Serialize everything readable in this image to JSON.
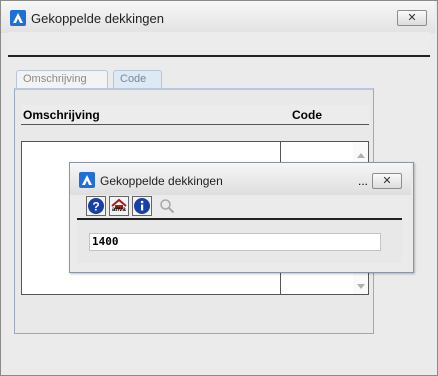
{
  "window": {
    "title": "Gekoppelde dekkingen",
    "close_label": "✕"
  },
  "tabs": [
    {
      "label": "Omschrijving",
      "active": false
    },
    {
      "label": "Code",
      "active": true
    }
  ],
  "grid": {
    "columns": [
      "Omschrijving",
      "Code"
    ],
    "rows": []
  },
  "dialog": {
    "title": "Gekoppelde dekkingen",
    "ellipsis": "...",
    "close_label": "✕",
    "toolbar": {
      "help_icon": "help-icon",
      "anva_icon": "anva-home-icon",
      "anva_label": "anva",
      "info_icon": "info-icon",
      "search_icon": "search-icon"
    },
    "value": "1400"
  },
  "colors": {
    "accent": "#1f6fd6",
    "help_blue": "#1a3fa8",
    "tab_active": "#dde9f5"
  }
}
